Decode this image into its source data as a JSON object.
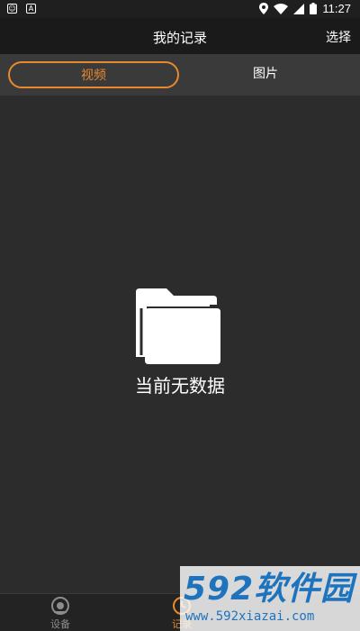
{
  "status_bar": {
    "time": "11:27",
    "icons": [
      "notification-icon",
      "app-icon",
      "location-icon",
      "wifi-icon",
      "signal-icon",
      "battery-icon"
    ]
  },
  "nav": {
    "title": "我的记录",
    "select_label": "选择"
  },
  "tabs": [
    {
      "label": "视频",
      "active": true
    },
    {
      "label": "图片",
      "active": false
    }
  ],
  "empty_state": {
    "icon": "folder-icon",
    "text": "当前无数据"
  },
  "bottom_nav": [
    {
      "label": "设备",
      "icon": "camera-icon",
      "active": false
    },
    {
      "label": "记录",
      "icon": "record-icon",
      "active": true
    }
  ],
  "watermark": {
    "logo": "592软件园",
    "url": "www.592xiazai.com"
  },
  "colors": {
    "accent": "#e8892c",
    "background": "#2c2c2c",
    "nav_background": "#1a1a1a",
    "tab_background": "#3a3a3a",
    "watermark": "#1e73be"
  }
}
